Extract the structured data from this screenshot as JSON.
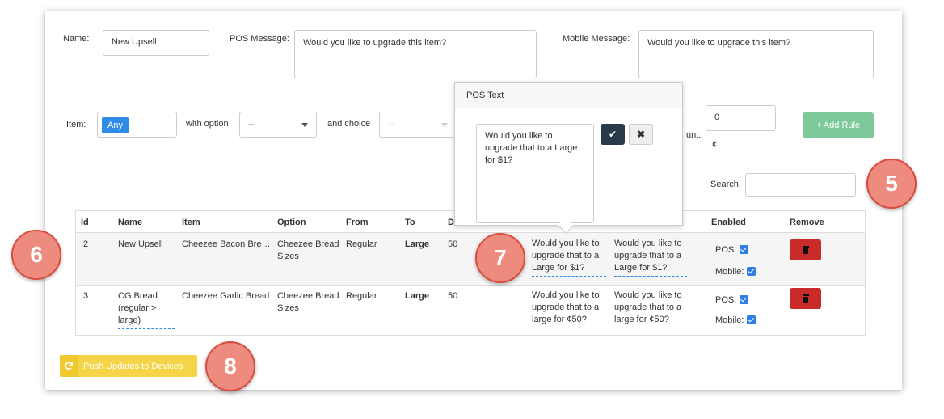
{
  "form": {
    "name_label": "Name:",
    "name_value": "New Upsell",
    "pos_message_label": "POS Message:",
    "pos_message_value": "Would you like to upgrade this item?",
    "mobile_message_label": "Mobile Message:",
    "mobile_message_value": "Would you like to upgrade this item?",
    "item_label": "Item:",
    "item_chip": "Any",
    "with_option_label": "with option",
    "option_select": "--",
    "and_choice_label": "and choice",
    "choice_select": "--",
    "amount_label": "unt:",
    "amount_value": "0",
    "currency_symbol": "¢",
    "add_rule_label": "+ Add Rule",
    "search_label": "Search:",
    "search_value": ""
  },
  "popover": {
    "title": "POS Text",
    "text": "Would you like to upgrade that to a Large for $1?",
    "confirm_icon": "check-icon",
    "cancel_icon": "close-icon"
  },
  "table": {
    "headers": [
      "Id",
      "Name",
      "Item",
      "Option",
      "From",
      "To",
      "Di",
      "Enabled",
      "Remove"
    ],
    "rows": [
      {
        "id": "I2",
        "name": "New Upsell",
        "item": "Cheezee Bacon Bre…",
        "option": "Cheezee Bread Sizes",
        "from": "Regular",
        "to": "Large",
        "discount": "50",
        "pos_text": "Would you like to upgrade that to a Large for $1?",
        "mobile_text": "Would you like to upgrade that to a Large for $1?",
        "pos_enabled_label": "POS:",
        "mobile_enabled_label": "Mobile:"
      },
      {
        "id": "I3",
        "name": "CG Bread (regular > large)",
        "item": "Cheezee Garlic Bread",
        "option": "Cheezee Bread Sizes",
        "from": "Regular",
        "to": "Large",
        "discount": "50",
        "pos_text": "Would you like to upgrade that to a large for ¢50?",
        "mobile_text": "Would you like to upgrade that to a large for ¢50?",
        "pos_enabled_label": "POS:",
        "mobile_enabled_label": "Mobile:"
      }
    ]
  },
  "push_button_label": "Push Updates to Devices",
  "callouts": [
    "5",
    "6",
    "7",
    "8"
  ],
  "colors": {
    "primary_blue": "#2f8be6",
    "add_rule_green": "#7ec99a",
    "remove_red": "#c92a2a",
    "push_yellow": "#f5d547",
    "callout_fill": "#ee8b7f"
  }
}
